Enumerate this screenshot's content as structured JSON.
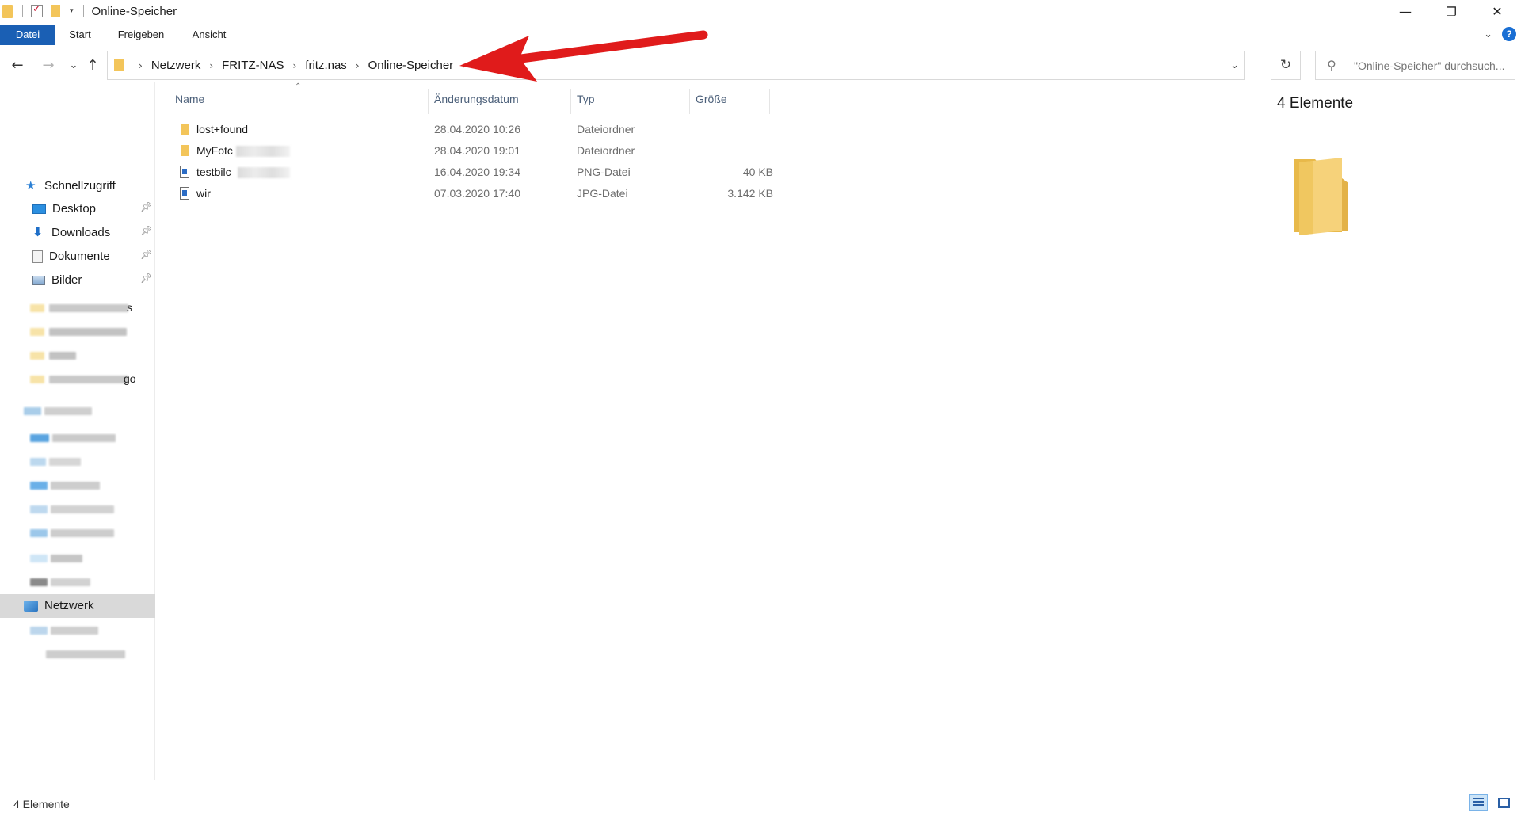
{
  "window": {
    "title": "Online-Speicher",
    "controls": {
      "minimize": "—",
      "maximize": "❐",
      "close": "✕"
    }
  },
  "ribbon": {
    "tabs": [
      {
        "label": "Datei",
        "active": true
      },
      {
        "label": "Start",
        "active": false
      },
      {
        "label": "Freigeben",
        "active": false
      },
      {
        "label": "Ansicht",
        "active": false
      }
    ],
    "accent": "#1a5fb4"
  },
  "nav": {
    "back": "←",
    "forward": "→",
    "recent": "⌄",
    "up": "↑",
    "breadcrumb": [
      "Netzwerk",
      "FRITZ-NAS",
      "fritz.nas",
      "Online-Speicher"
    ],
    "refresh": "↻",
    "search_placeholder": "\"Online-Speicher\" durchsuch..."
  },
  "sidebar": {
    "quick_access": "Schnellzugriff",
    "pinned": [
      {
        "label": "Desktop",
        "icon": "desktop-icon"
      },
      {
        "label": "Downloads",
        "icon": "downloads-icon"
      },
      {
        "label": "Dokumente",
        "icon": "documents-icon"
      },
      {
        "label": "Bilder",
        "icon": "pictures-icon"
      }
    ],
    "redacted_suffixes": [
      "s",
      "go"
    ],
    "network": "Netzwerk"
  },
  "columns": [
    "Name",
    "Änderungsdatum",
    "Typ",
    "Größe"
  ],
  "files": [
    {
      "name": "lost+found",
      "date": "28.04.2020 10:26",
      "type": "Dateiordner",
      "size": "",
      "icon": "folder-icon"
    },
    {
      "name": "MyFotc",
      "date": "28.04.2020 19:01",
      "type": "Dateiordner",
      "size": "",
      "icon": "folder-icon"
    },
    {
      "name": "testbilc",
      "date": "16.04.2020 19:34",
      "type": "PNG-Datei",
      "size": "40 KB",
      "icon": "image-file-icon"
    },
    {
      "name": "wir",
      "date": "07.03.2020 17:40",
      "type": "JPG-Datei",
      "size": "3.142 KB",
      "icon": "image-file-icon"
    }
  ],
  "preview": {
    "title": "4 Elemente"
  },
  "status": {
    "count": "4 Elemente"
  }
}
